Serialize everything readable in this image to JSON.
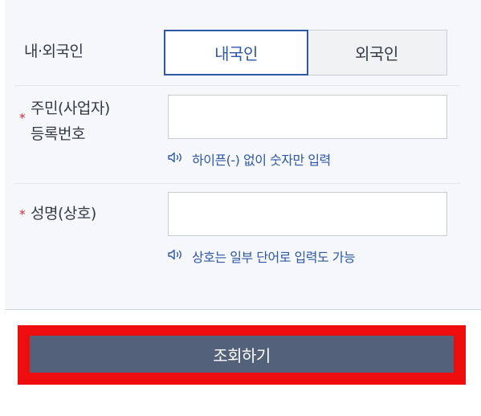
{
  "form": {
    "nationality": {
      "label": "내·외국인",
      "options": [
        "내국인",
        "외국인"
      ],
      "selected": "내국인"
    },
    "resident_number": {
      "required_mark": "*",
      "label_line1": "주민(사업자)",
      "label_line2": "등록번호",
      "value": "",
      "hint": "하이픈(-) 없이 숫자만 입력"
    },
    "name": {
      "required_mark": "*",
      "label": "성명(상호)",
      "value": "",
      "hint": "상호는 일부 단어로 입력도 가능"
    }
  },
  "submit": {
    "label": "조회하기"
  },
  "colors": {
    "accent": "#2c58a8",
    "required": "#e2262e",
    "button": "#53627a",
    "highlight": "#ee0d0d",
    "panel": "#f6f7fa"
  },
  "icons": {
    "hint": "speaker-icon"
  }
}
